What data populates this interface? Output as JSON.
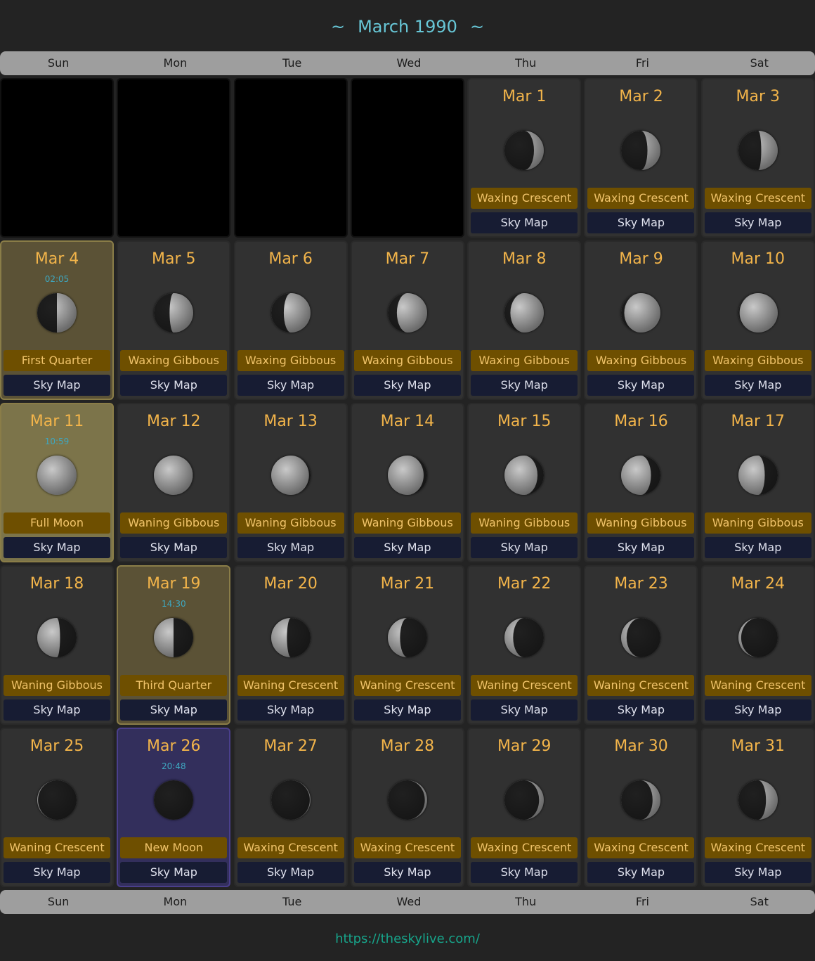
{
  "header": {
    "title": "March 1990",
    "tilde_left": "~",
    "tilde_right": "~"
  },
  "weekdays": [
    "Sun",
    "Mon",
    "Tue",
    "Wed",
    "Thu",
    "Fri",
    "Sat"
  ],
  "sky_map_label": "Sky Map",
  "leading_empty_cells": 4,
  "days": [
    {
      "date": "Mar 1",
      "phase": "Waxing Crescent",
      "illumination": 0.25,
      "waxing": true
    },
    {
      "date": "Mar 2",
      "phase": "Waxing Crescent",
      "illumination": 0.33,
      "waxing": true
    },
    {
      "date": "Mar 3",
      "phase": "Waxing Crescent",
      "illumination": 0.42,
      "waxing": true
    },
    {
      "date": "Mar 4",
      "phase": "First Quarter",
      "time": "02:05",
      "illumination": 0.5,
      "waxing": true,
      "highlight": "quarter"
    },
    {
      "date": "Mar 5",
      "phase": "Waxing Gibbous",
      "illumination": 0.6,
      "waxing": true
    },
    {
      "date": "Mar 6",
      "phase": "Waxing Gibbous",
      "illumination": 0.68,
      "waxing": true
    },
    {
      "date": "Mar 7",
      "phase": "Waxing Gibbous",
      "illumination": 0.77,
      "waxing": true
    },
    {
      "date": "Mar 8",
      "phase": "Waxing Gibbous",
      "illumination": 0.85,
      "waxing": true
    },
    {
      "date": "Mar 9",
      "phase": "Waxing Gibbous",
      "illumination": 0.92,
      "waxing": true
    },
    {
      "date": "Mar 10",
      "phase": "Waxing Gibbous",
      "illumination": 0.97,
      "waxing": true
    },
    {
      "date": "Mar 11",
      "phase": "Full Moon",
      "time": "10:59",
      "illumination": 1.0,
      "waxing": false,
      "highlight": "full"
    },
    {
      "date": "Mar 12",
      "phase": "Waning Gibbous",
      "illumination": 0.99,
      "waxing": false
    },
    {
      "date": "Mar 13",
      "phase": "Waning Gibbous",
      "illumination": 0.96,
      "waxing": false
    },
    {
      "date": "Mar 14",
      "phase": "Waning Gibbous",
      "illumination": 0.91,
      "waxing": false
    },
    {
      "date": "Mar 15",
      "phase": "Waning Gibbous",
      "illumination": 0.84,
      "waxing": false
    },
    {
      "date": "Mar 16",
      "phase": "Waning Gibbous",
      "illumination": 0.76,
      "waxing": false
    },
    {
      "date": "Mar 17",
      "phase": "Waning Gibbous",
      "illumination": 0.67,
      "waxing": false
    },
    {
      "date": "Mar 18",
      "phase": "Waning Gibbous",
      "illumination": 0.58,
      "waxing": false
    },
    {
      "date": "Mar 19",
      "phase": "Third Quarter",
      "time": "14:30",
      "illumination": 0.5,
      "waxing": false,
      "highlight": "quarter"
    },
    {
      "date": "Mar 20",
      "phase": "Waning Crescent",
      "illumination": 0.4,
      "waxing": false
    },
    {
      "date": "Mar 21",
      "phase": "Waning Crescent",
      "illumination": 0.31,
      "waxing": false
    },
    {
      "date": "Mar 22",
      "phase": "Waning Crescent",
      "illumination": 0.22,
      "waxing": false
    },
    {
      "date": "Mar 23",
      "phase": "Waning Crescent",
      "illumination": 0.14,
      "waxing": false
    },
    {
      "date": "Mar 24",
      "phase": "Waning Crescent",
      "illumination": 0.07,
      "waxing": false
    },
    {
      "date": "Mar 25",
      "phase": "Waning Crescent",
      "illumination": 0.02,
      "waxing": false
    },
    {
      "date": "Mar 26",
      "phase": "New Moon",
      "time": "20:48",
      "illumination": 0.0,
      "waxing": true,
      "highlight": "newm"
    },
    {
      "date": "Mar 27",
      "phase": "Waxing Crescent",
      "illumination": 0.02,
      "waxing": true
    },
    {
      "date": "Mar 28",
      "phase": "Waxing Crescent",
      "illumination": 0.06,
      "waxing": true
    },
    {
      "date": "Mar 29",
      "phase": "Waxing Crescent",
      "illumination": 0.12,
      "waxing": true
    },
    {
      "date": "Mar 30",
      "phase": "Waxing Crescent",
      "illumination": 0.2,
      "waxing": true
    },
    {
      "date": "Mar 31",
      "phase": "Waxing Crescent",
      "illumination": 0.3,
      "waxing": true
    }
  ],
  "footer": {
    "link": "https://theskylive.com/"
  }
}
